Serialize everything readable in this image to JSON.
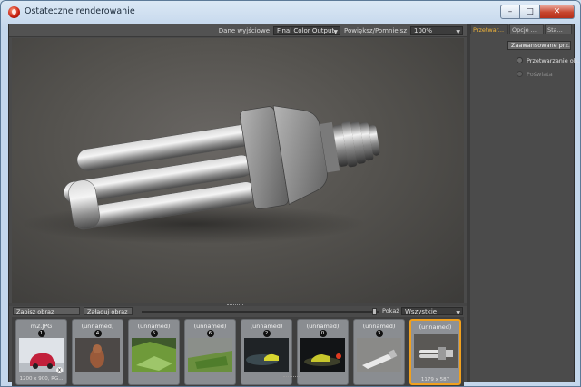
{
  "window": {
    "title": "Ostateczne renderowanie",
    "min_glyph": "–",
    "max_glyph": "□",
    "close_glyph": "✕"
  },
  "render_view": {
    "output_label": "Dane wyjściowe",
    "output_value": "Final Color Output",
    "zoom_label": "Powiększ/Pomniejsz",
    "zoom_value": "100%"
  },
  "toolbar": {
    "save_label": "Zapisz obraz",
    "load_label": "Załaduj obraz",
    "show_label": "Pokaż",
    "show_value": "Wszystkie"
  },
  "thumbnails": [
    {
      "name": "m2.JPG",
      "badge": "1",
      "info": "1200 x 900, RG...",
      "remove": "×"
    },
    {
      "name": "(unnamed)",
      "badge": "4",
      "info": ""
    },
    {
      "name": "(unnamed)",
      "badge": "5",
      "info": ""
    },
    {
      "name": "(unnamed)",
      "badge": "6",
      "info": ""
    },
    {
      "name": "(unnamed)",
      "badge": "2",
      "info": ""
    },
    {
      "name": "(unnamed)",
      "badge": "0",
      "info": ""
    },
    {
      "name": "(unnamed)",
      "badge": "3",
      "info": ""
    },
    {
      "name": "(unnamed)",
      "badge": "",
      "info": "1179 x 587"
    }
  ],
  "side_panel": {
    "tabs": [
      "Przetwar...",
      "Opcje ...",
      "Sta..."
    ],
    "advanced_button": "Zaawansowane prz...",
    "option_processing": "Przetwarzanie ob...",
    "option_glow": "Poświata"
  },
  "colors": {
    "accent": "#f0a01e",
    "panel_bg": "#4a4a4a",
    "close_red": "#c6432c"
  }
}
